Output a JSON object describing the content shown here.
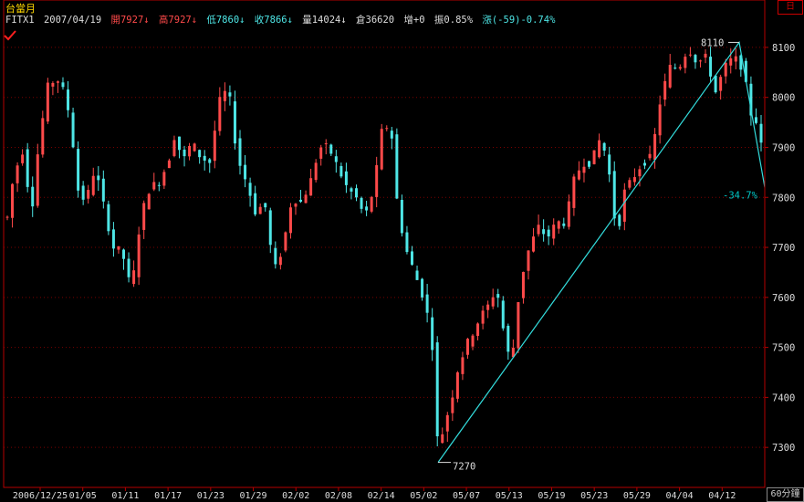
{
  "header": {
    "title": "台當月",
    "symbol": "FITX1",
    "date": "2007/04/19",
    "open": "開7927↓",
    "high": "高7927↓",
    "low": "低7860↓",
    "close": "收7866↓",
    "volume": "量14024↓",
    "oi": "倉36620",
    "oi_change": "增+0",
    "amplitude": "振0.85%",
    "change": "漲(-59)-0.74%"
  },
  "badges": {
    "day": "日",
    "period": "60分鐘"
  },
  "colors": {
    "up": "#ff4a4a",
    "down": "#4ee6e6",
    "trendline": "#33dddd",
    "grid": "#7a0000",
    "axis": "#b40000",
    "label": "#00c8c8"
  },
  "chart_data": {
    "type": "candlestick",
    "x_ticks": [
      "2006/12/25",
      "01/05",
      "01/11",
      "01/17",
      "01/23",
      "01/29",
      "02/02",
      "02/08",
      "02/14",
      "05/02",
      "05/07",
      "05/13",
      "05/19",
      "05/23",
      "05/29",
      "04/04",
      "04/12"
    ],
    "y_ticks": [
      7300,
      7400,
      7500,
      7600,
      7700,
      7800,
      7900,
      8000,
      8100
    ],
    "ylim": [
      7220,
      8140
    ],
    "grid": true,
    "annotations": {
      "high_label": "8110",
      "low_label": "7270",
      "retrace_label": "-34.7%"
    },
    "trendline": [
      {
        "ref": "low",
        "value": 7270
      },
      {
        "ref": "high",
        "value": 8110
      },
      {
        "ref": "last",
        "value": 7820
      }
    ],
    "series_path": [
      [
        0,
        7680
      ],
      [
        6,
        7800
      ],
      [
        14,
        7860
      ],
      [
        22,
        7900
      ],
      [
        30,
        7760
      ],
      [
        38,
        7900
      ],
      [
        48,
        8020
      ],
      [
        58,
        8040
      ],
      [
        66,
        8010
      ],
      [
        74,
        7950
      ],
      [
        80,
        7820
      ],
      [
        90,
        7790
      ],
      [
        100,
        7860
      ],
      [
        110,
        7780
      ],
      [
        120,
        7700
      ],
      [
        130,
        7690
      ],
      [
        140,
        7610
      ],
      [
        150,
        7760
      ],
      [
        160,
        7820
      ],
      [
        170,
        7830
      ],
      [
        180,
        7870
      ],
      [
        188,
        7930
      ],
      [
        196,
        7870
      ],
      [
        206,
        7910
      ],
      [
        216,
        7880
      ],
      [
        226,
        7870
      ],
      [
        236,
        7990
      ],
      [
        246,
        8020
      ],
      [
        256,
        7880
      ],
      [
        266,
        7830
      ],
      [
        276,
        7770
      ],
      [
        286,
        7790
      ],
      [
        296,
        7650
      ],
      [
        306,
        7700
      ],
      [
        316,
        7800
      ],
      [
        326,
        7790
      ],
      [
        336,
        7830
      ],
      [
        346,
        7900
      ],
      [
        356,
        7900
      ],
      [
        366,
        7860
      ],
      [
        376,
        7820
      ],
      [
        386,
        7800
      ],
      [
        396,
        7760
      ],
      [
        406,
        7820
      ],
      [
        414,
        7930
      ],
      [
        424,
        7950
      ],
      [
        432,
        7770
      ],
      [
        442,
        7690
      ],
      [
        452,
        7640
      ],
      [
        462,
        7590
      ],
      [
        470,
        7500
      ],
      [
        476,
        7290
      ],
      [
        482,
        7340
      ],
      [
        490,
        7390
      ],
      [
        498,
        7460
      ],
      [
        506,
        7500
      ],
      [
        514,
        7530
      ],
      [
        522,
        7560
      ],
      [
        530,
        7580
      ],
      [
        540,
        7620
      ],
      [
        548,
        7530
      ],
      [
        556,
        7460
      ],
      [
        566,
        7630
      ],
      [
        576,
        7700
      ],
      [
        586,
        7740
      ],
      [
        596,
        7720
      ],
      [
        606,
        7750
      ],
      [
        616,
        7750
      ],
      [
        624,
        7830
      ],
      [
        634,
        7870
      ],
      [
        644,
        7870
      ],
      [
        654,
        7920
      ],
      [
        662,
        7870
      ],
      [
        672,
        7720
      ],
      [
        680,
        7810
      ],
      [
        690,
        7840
      ],
      [
        700,
        7870
      ],
      [
        710,
        7880
      ],
      [
        720,
        8000
      ],
      [
        730,
        8060
      ],
      [
        740,
        8060
      ],
      [
        750,
        8100
      ],
      [
        760,
        8070
      ],
      [
        770,
        8080
      ],
      [
        780,
        8010
      ],
      [
        790,
        8060
      ],
      [
        800,
        8080
      ],
      [
        810,
        8060
      ],
      [
        818,
        7970
      ],
      [
        826,
        7950
      ],
      [
        832,
        7880
      ],
      [
        836,
        7840
      ]
    ]
  }
}
